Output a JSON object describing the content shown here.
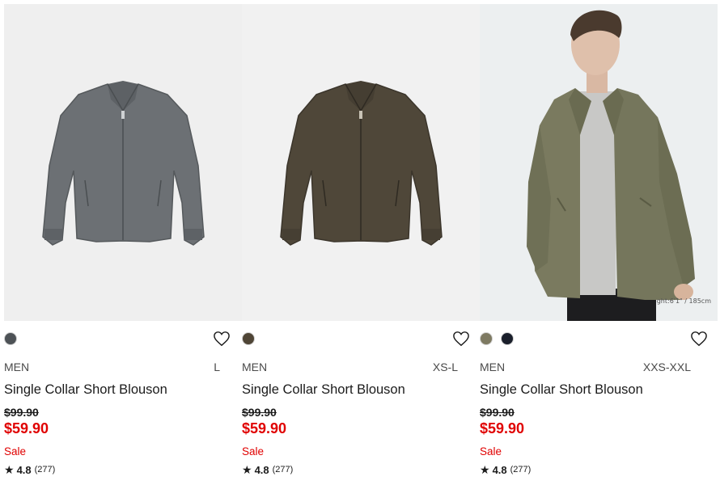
{
  "products": [
    {
      "image_alt": "Single Collar Short Blouson gray",
      "swatches": [
        {
          "color": "#4d5256",
          "name": "gray"
        }
      ],
      "gender": "MEN",
      "sizes": "L",
      "title": "Single Collar Short Blouson",
      "old_price": "$99.90",
      "new_price": "$59.90",
      "sale_label": "Sale",
      "rating": "4.8",
      "review_count": "(277)",
      "model_note": ""
    },
    {
      "image_alt": "Single Collar Short Blouson brown",
      "swatches": [
        {
          "color": "#4f4536",
          "name": "brown"
        }
      ],
      "gender": "MEN",
      "sizes": "XS-L",
      "title": "Single Collar Short Blouson",
      "old_price": "$99.90",
      "new_price": "$59.90",
      "sale_label": "Sale",
      "rating": "4.8",
      "review_count": "(277)",
      "model_note": ""
    },
    {
      "image_alt": "Single Collar Short Blouson olive worn by model",
      "swatches": [
        {
          "color": "#7e7a62",
          "name": "olive"
        },
        {
          "color": "#1a1f2b",
          "name": "navy"
        }
      ],
      "gender": "MEN",
      "sizes": "XXS-XXL",
      "title": "Single Collar Short Blouson",
      "old_price": "$99.90",
      "new_price": "$59.90",
      "sale_label": "Sale",
      "rating": "4.8",
      "review_count": "(277)",
      "model_note": "ght:6'1\" / 185cm"
    }
  ],
  "icons": {
    "heart": "heart-outline-icon",
    "star": "star-filled-icon"
  },
  "colors": {
    "sale_red": "#e00000",
    "text": "#1b1b1b"
  }
}
